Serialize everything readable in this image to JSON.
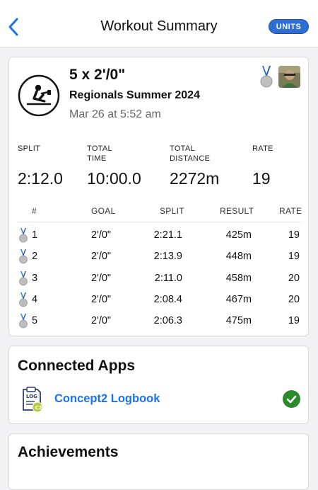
{
  "header": {
    "title": "Workout Summary",
    "units_label": "UNITS"
  },
  "workout": {
    "title": "5 x 2'/0\"",
    "subtitle": "Regionals Summer 2024",
    "date": "Mar 26 at 5:52 am"
  },
  "stats": [
    {
      "label_line1": "",
      "label_line2": "SPLIT",
      "value": "2:12.0"
    },
    {
      "label_line1": "TOTAL",
      "label_line2": "TIME",
      "value": "10:00.0"
    },
    {
      "label_line1": "TOTAL",
      "label_line2": "DISTANCE",
      "value": "2272m"
    },
    {
      "label_line1": "",
      "label_line2": "RATE",
      "value": "19"
    }
  ],
  "table": {
    "headers": [
      "#",
      "GOAL",
      "SPLIT",
      "RESULT",
      "RATE"
    ],
    "rows": [
      {
        "num": "1",
        "goal": "2'/0\"",
        "split": "2:21.1",
        "result": "425m",
        "rate": "19"
      },
      {
        "num": "2",
        "goal": "2'/0\"",
        "split": "2:13.9",
        "result": "448m",
        "rate": "19"
      },
      {
        "num": "3",
        "goal": "2'/0\"",
        "split": "2:11.0",
        "result": "458m",
        "rate": "20"
      },
      {
        "num": "4",
        "goal": "2'/0\"",
        "split": "2:08.4",
        "result": "467m",
        "rate": "20"
      },
      {
        "num": "5",
        "goal": "2'/0\"",
        "split": "2:06.3",
        "result": "475m",
        "rate": "19"
      }
    ]
  },
  "connected_apps": {
    "title": "Connected Apps",
    "apps": [
      {
        "name": "Concept2 Logbook",
        "icon": "logbook-icon",
        "status": "connected"
      }
    ]
  },
  "achievements": {
    "title": "Achievements"
  },
  "colors": {
    "accent": "#1a73e8",
    "units_button": "#2e6fd6",
    "success": "#2b8a2b",
    "medal_ribbon": "#3b6fd1"
  }
}
